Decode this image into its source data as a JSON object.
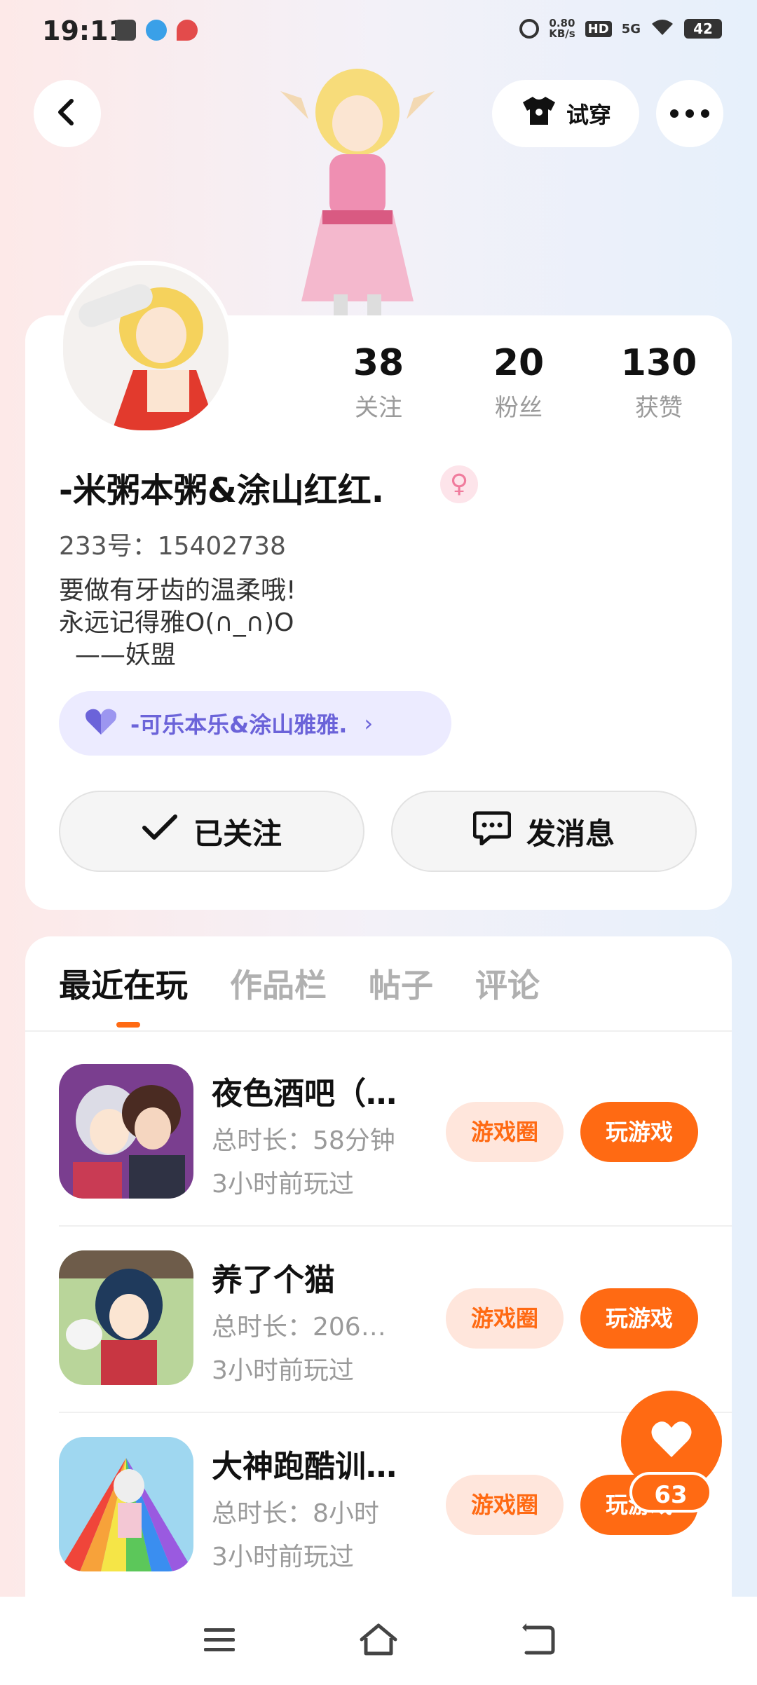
{
  "status_bar": {
    "time": "19:11",
    "net_speed_value": "0.80",
    "net_speed_unit": "KB/s",
    "hd": "HD",
    "signal": "5G",
    "battery": "42"
  },
  "header": {
    "try_on_label": "试穿"
  },
  "profile": {
    "stats": [
      {
        "value": "38",
        "label": "关注"
      },
      {
        "value": "20",
        "label": "粉丝"
      },
      {
        "value": "130",
        "label": "获赞"
      }
    ],
    "username": "-米粥本粥&涂山红红.",
    "gender_symbol": "♀",
    "user_id": "233号：15402738",
    "bio": "要做有牙齿的温柔哦!\n永远记得雅O(∩_∩)O\n  ——妖盟",
    "couple": {
      "name": "-可乐本乐&涂山雅雅.",
      "arrow": "›"
    },
    "followed_label": "已关注",
    "message_label": "发消息"
  },
  "tabs": [
    "最近在玩",
    "作品栏",
    "帖子",
    "评论"
  ],
  "games": [
    {
      "title": "夜色酒吧（…",
      "duration": "总时长：58分钟",
      "last_played": "3小时前玩过",
      "circle_label": "游戏圈",
      "play_label": "玩游戏"
    },
    {
      "title": "养了个猫",
      "duration": "总时长：206…",
      "last_played": "3小时前玩过",
      "circle_label": "游戏圈",
      "play_label": "玩游戏"
    },
    {
      "title": "大神跑酷训…",
      "duration": "总时长：8小时",
      "last_played": "3小时前玩过",
      "circle_label": "游戏圈",
      "play_label": "玩游戏"
    }
  ],
  "like_fab": {
    "count": "63"
  },
  "colors": {
    "accent": "#ff6a13",
    "couple_text": "#6b63d9",
    "couple_bg": "#ecebff"
  },
  "icons": [
    "back-arrow-icon",
    "shirt-icon",
    "more-icon",
    "check-icon",
    "message-icon",
    "heart-icon",
    "menu-icon",
    "home-icon",
    "back-icon"
  ]
}
